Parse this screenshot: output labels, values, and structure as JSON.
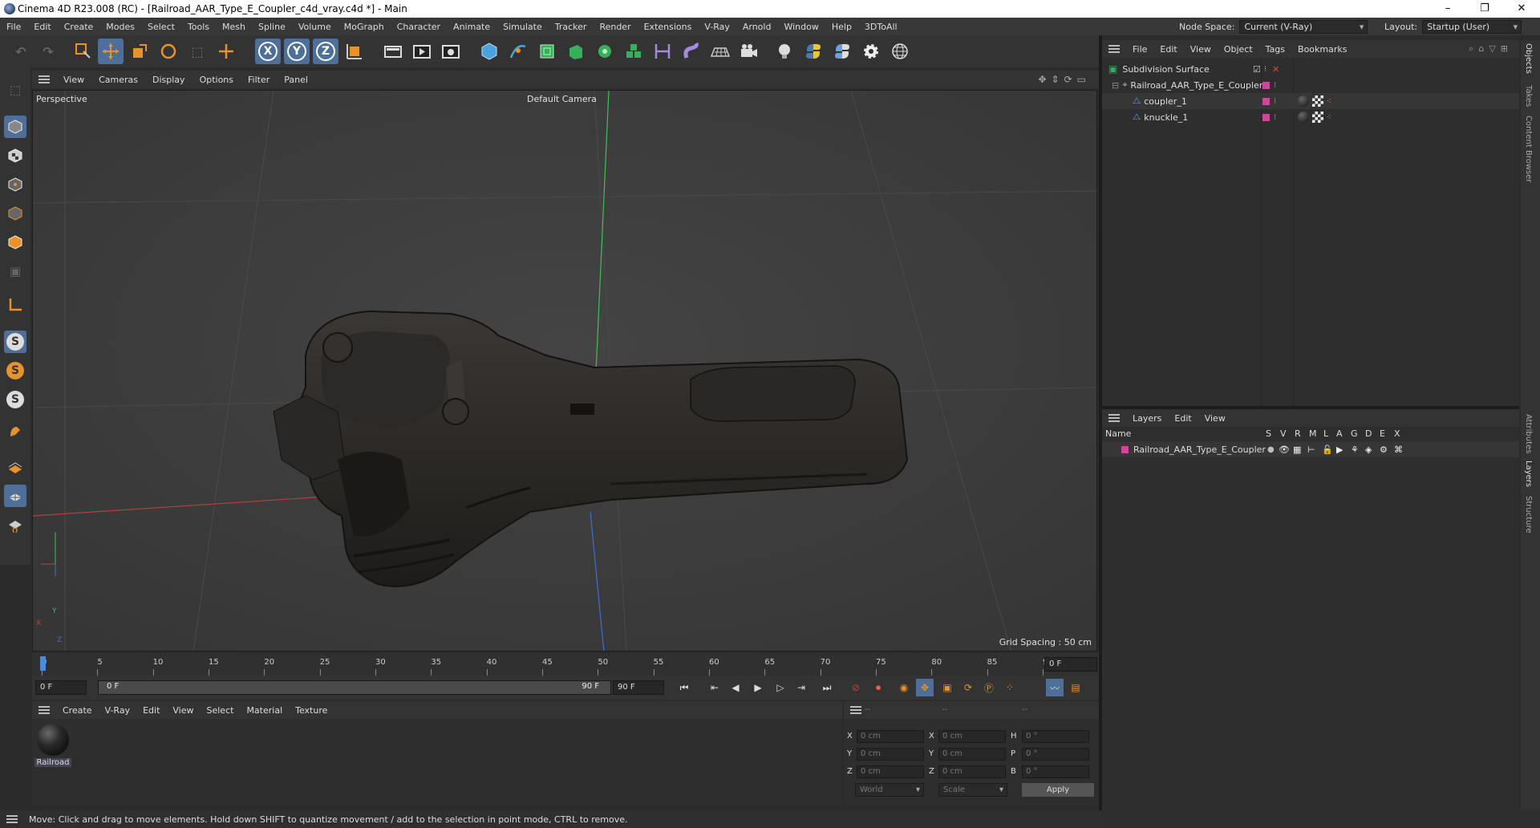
{
  "window": {
    "title": "Cinema 4D R23.008 (RC) - [Railroad_AAR_Type_E_Coupler_c4d_vray.c4d *] - Main",
    "controls": [
      "–",
      "❐",
      "✕"
    ]
  },
  "menubar": {
    "items": [
      "File",
      "Edit",
      "Create",
      "Modes",
      "Select",
      "Tools",
      "Mesh",
      "Spline",
      "Volume",
      "MoGraph",
      "Character",
      "Animate",
      "Simulate",
      "Tracker",
      "Render",
      "Extensions",
      "V-Ray",
      "Arnold",
      "Window",
      "Help",
      "3DToAll"
    ],
    "node_space_label": "Node Space:",
    "node_space_value": "Current (V-Ray)",
    "layout_label": "Layout:",
    "layout_value": "Startup (User)"
  },
  "toolbar": {
    "axis_x": "X",
    "axis_y": "Y",
    "axis_z": "Z"
  },
  "left_toolbar": {
    "snap_s": "S"
  },
  "viewport_menu": {
    "items": [
      "View",
      "Cameras",
      "Display",
      "Options",
      "Filter",
      "Panel"
    ]
  },
  "viewport": {
    "view_name": "Perspective",
    "camera": "Default Camera",
    "grid_spacing": "Grid Spacing : 50 cm",
    "axis_x": "X",
    "axis_y": "Y",
    "axis_z": "Z"
  },
  "timeline": {
    "ticks": [
      "0",
      "5",
      "10",
      "15",
      "20",
      "25",
      "30",
      "35",
      "40",
      "45",
      "50",
      "55",
      "60",
      "65",
      "70",
      "75",
      "80",
      "85",
      "90"
    ],
    "current_frame": "0 F"
  },
  "transport": {
    "start_frame": "0 F",
    "range_start": "0 F",
    "range_end": "90 F",
    "end_frame": "90 F"
  },
  "material_manager": {
    "menu": [
      "Create",
      "V-Ray",
      "Edit",
      "View",
      "Select",
      "Material",
      "Texture"
    ],
    "materials": [
      {
        "name": "Railroad"
      }
    ]
  },
  "coordinates": {
    "header": [
      "--",
      "--",
      "--"
    ],
    "rows": [
      {
        "a": "X",
        "av": "0 cm",
        "b": "X",
        "bv": "0 cm",
        "c": "H",
        "cv": "0 °"
      },
      {
        "a": "Y",
        "av": "0 cm",
        "b": "Y",
        "bv": "0 cm",
        "c": "P",
        "cv": "0 °"
      },
      {
        "a": "Z",
        "av": "0 cm",
        "b": "Z",
        "bv": "0 cm",
        "c": "B",
        "cv": "0 °"
      }
    ],
    "world": "World",
    "scale": "Scale",
    "apply": "Apply"
  },
  "object_manager": {
    "menu": [
      "File",
      "Edit",
      "View",
      "Object",
      "Tags",
      "Bookmarks"
    ],
    "objects": [
      {
        "name": "Subdivision Surface"
      },
      {
        "name": "Railroad_AAR_Type_E_Coupler"
      },
      {
        "name": "coupler_1"
      },
      {
        "name": "knuckle_1"
      }
    ]
  },
  "layer_manager": {
    "menu": [
      "Layers",
      "Edit",
      "View"
    ],
    "col_name": "Name",
    "cols": [
      "S",
      "V",
      "R",
      "M",
      "L",
      "A",
      "G",
      "D",
      "E",
      "X"
    ],
    "layers": [
      {
        "name": "Railroad_AAR_Type_E_Coupler"
      }
    ]
  },
  "right_tabs": [
    "Objects",
    "Takes",
    "Content Browser",
    "Attributes",
    "Layers",
    "Structure"
  ],
  "status": {
    "text": "Move: Click and drag to move elements. Hold down SHIFT to quantize movement / add to the selection in point mode, CTRL to remove."
  },
  "colors": {
    "accent": "#4e6f9a",
    "layer_tag": "#d0479a",
    "axis_x": "#c8413a",
    "axis_y": "#3fbf5a",
    "axis_z": "#3f6fd0",
    "orange_icon": "#e8922a"
  }
}
